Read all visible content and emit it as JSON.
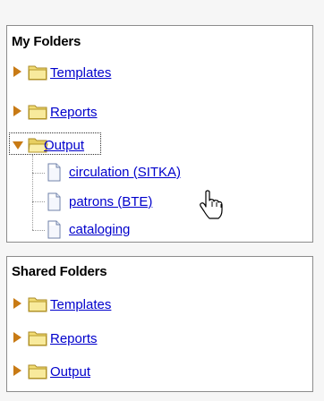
{
  "my_folders": {
    "title": "My Folders",
    "templates": "Templates",
    "reports": "Reports",
    "output": "Output",
    "output_children": [
      "circulation (SITKA)",
      "patrons (BTE)",
      "cataloging"
    ]
  },
  "shared_folders": {
    "title": "Shared Folders",
    "templates": "Templates",
    "reports": "Reports",
    "output": "Output"
  },
  "colors": {
    "link": "#0000cc",
    "arrow": "#c87a14",
    "folder_fill": "#f6e48a",
    "border": "#8c8c8c"
  },
  "icons": {
    "collapsed": "triangle-right-icon",
    "expanded": "triangle-down-icon",
    "folder": "folder-icon",
    "document": "document-icon",
    "cursor": "hand-pointer-icon"
  }
}
